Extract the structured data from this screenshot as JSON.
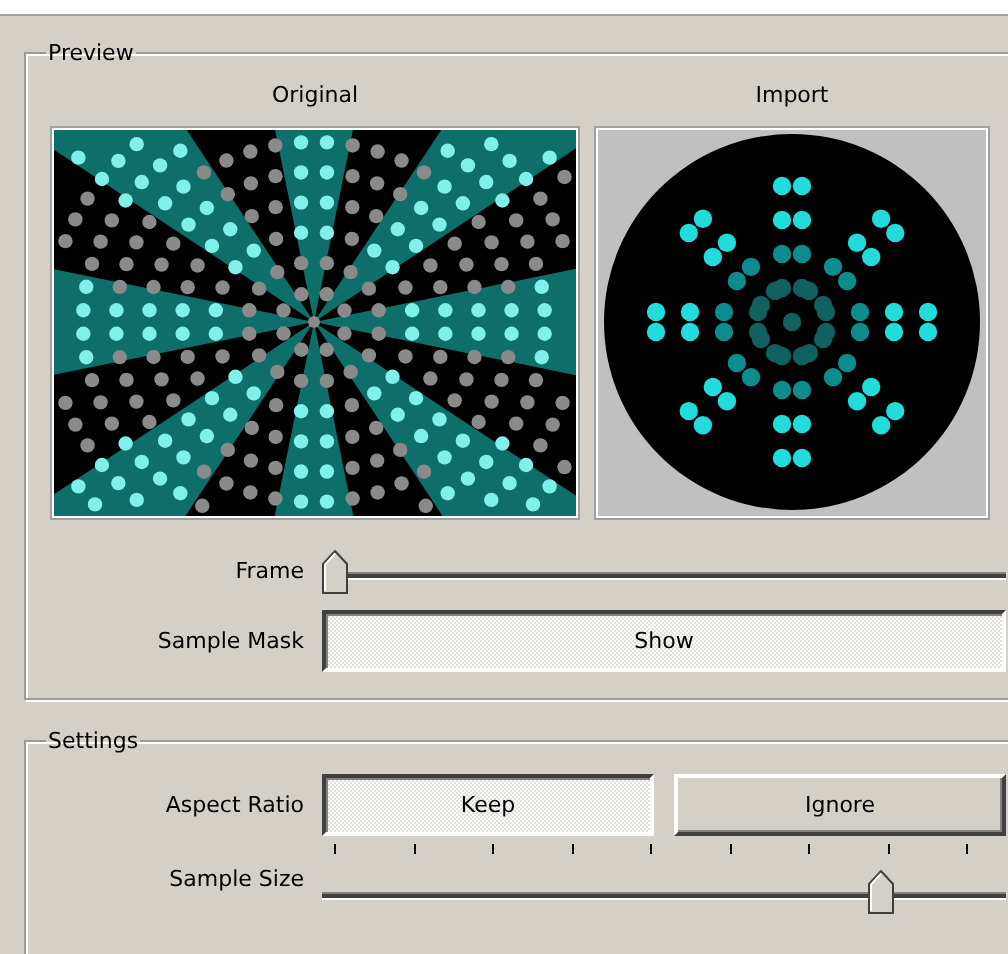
{
  "preview": {
    "title": "Preview",
    "panes": [
      {
        "label": "Original",
        "kind": "starburst"
      },
      {
        "label": "Import",
        "kind": "dots"
      }
    ],
    "frame": {
      "label": "Frame",
      "level": 0
    },
    "sample_mask": {
      "label": "Sample Mask",
      "button": "Show",
      "selected": true
    }
  },
  "settings": {
    "title": "Settings",
    "aspect_ratio": {
      "label": "Aspect Ratio",
      "options": [
        {
          "label": "Keep",
          "selected": true
        },
        {
          "label": "Ignore",
          "selected": false
        }
      ]
    },
    "sample_size": {
      "label": "Sample Size",
      "level": 0.83
    }
  }
}
